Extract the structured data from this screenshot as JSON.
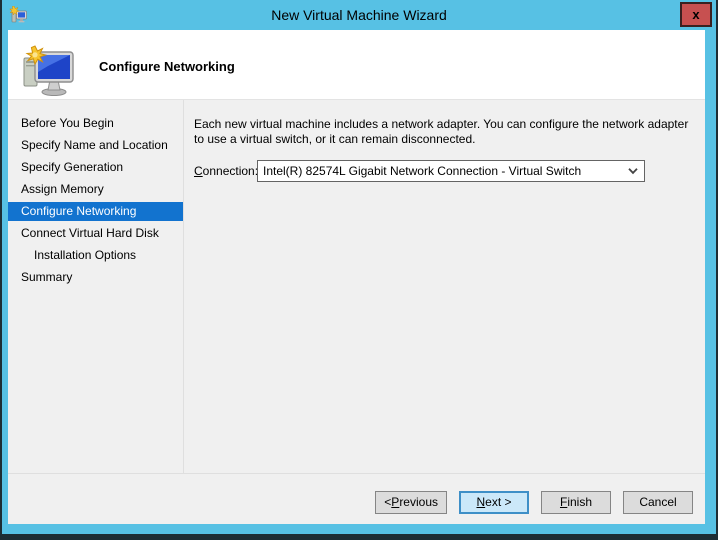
{
  "window": {
    "title": "New Virtual Machine Wizard",
    "close_label": "x"
  },
  "header": {
    "title": "Configure Networking"
  },
  "sidebar": {
    "items": [
      {
        "label": "Before You Begin",
        "selected": false,
        "indented": false
      },
      {
        "label": "Specify Name and Location",
        "selected": false,
        "indented": false
      },
      {
        "label": "Specify Generation",
        "selected": false,
        "indented": false
      },
      {
        "label": "Assign Memory",
        "selected": false,
        "indented": false
      },
      {
        "label": "Configure Networking",
        "selected": true,
        "indented": false
      },
      {
        "label": "Connect Virtual Hard Disk",
        "selected": false,
        "indented": false
      },
      {
        "label": "Installation Options",
        "selected": false,
        "indented": true
      },
      {
        "label": "Summary",
        "selected": false,
        "indented": false
      }
    ]
  },
  "main": {
    "description": "Each new virtual machine includes a network adapter. You can configure the network adapter to use a virtual switch, or it can remain disconnected.",
    "connection_label": {
      "key": "C",
      "rest": "onnection:"
    },
    "connection_value": "Intel(R) 82574L Gigabit Network Connection - Virtual Switch",
    "dropdown_icon": "chevron-down-icon"
  },
  "footer": {
    "buttons": {
      "previous": {
        "pre": "< ",
        "key": "P",
        "post": "revious"
      },
      "next": {
        "pre": "",
        "key": "N",
        "post": "ext >"
      },
      "finish": {
        "pre": "",
        "key": "F",
        "post": "inish"
      },
      "cancel": {
        "pre": "",
        "key": "",
        "post": "Cancel"
      }
    }
  },
  "colors": {
    "frame_blue": "#57c1e4",
    "selected_item": "#1273cf",
    "close_red": "#c75050",
    "default_button_fill": "#cbe8f9",
    "default_button_border": "#3e8fc7",
    "body_gray": "#f0f0f0"
  }
}
